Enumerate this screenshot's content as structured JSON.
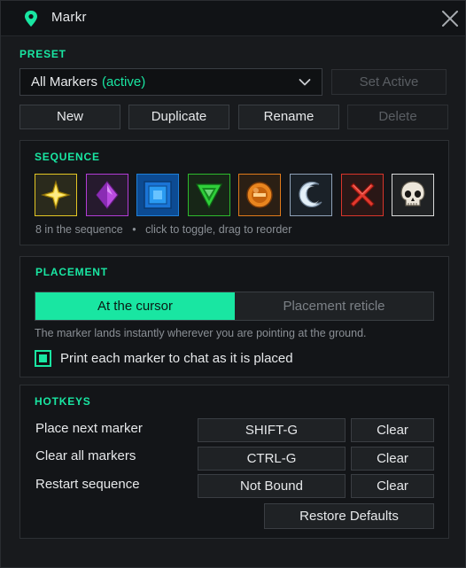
{
  "window": {
    "title": "Markr",
    "accent": "#19e6a2"
  },
  "preset": {
    "section_label": "PRESET",
    "selected_name": "All Markers",
    "selected_status": "(active)",
    "buttons": {
      "set_active": "Set Active",
      "new": "New",
      "duplicate": "Duplicate",
      "rename": "Rename",
      "delete": "Delete"
    }
  },
  "sequence": {
    "section_label": "SEQUENCE",
    "markers": [
      {
        "icon": "yellow-star-icon",
        "color": "#e3c624"
      },
      {
        "icon": "purple-diamond-icon",
        "color": "#b23cd6"
      },
      {
        "icon": "blue-square-icon",
        "color": "#1e7fd8"
      },
      {
        "icon": "green-triangle-icon",
        "color": "#2dba2d"
      },
      {
        "icon": "orange-circle-icon",
        "color": "#e07a1a"
      },
      {
        "icon": "silver-moon-icon",
        "color": "#8fa2b8"
      },
      {
        "icon": "red-cross-icon",
        "color": "#d9352b"
      },
      {
        "icon": "white-skull-icon",
        "color": "#d9d9d9"
      }
    ],
    "count_text": "8 in the sequence",
    "separator": "•",
    "help_text": "click to toggle, drag to reorder"
  },
  "placement": {
    "section_label": "PLACEMENT",
    "options": [
      "At the cursor",
      "Placement reticle"
    ],
    "selected": "At the cursor",
    "description": "The marker lands instantly wherever you are pointing at the ground.",
    "print_to_chat": {
      "label": "Print each marker to chat as it is placed",
      "checked": true
    }
  },
  "hotkeys": {
    "section_label": "HOTKEYS",
    "rows": [
      {
        "label": "Place next marker",
        "binding": "SHIFT-G",
        "clear": "Clear"
      },
      {
        "label": "Clear all markers",
        "binding": "CTRL-G",
        "clear": "Clear"
      },
      {
        "label": "Restart sequence",
        "binding": "Not Bound",
        "clear": "Clear"
      }
    ],
    "restore_defaults": "Restore Defaults"
  }
}
